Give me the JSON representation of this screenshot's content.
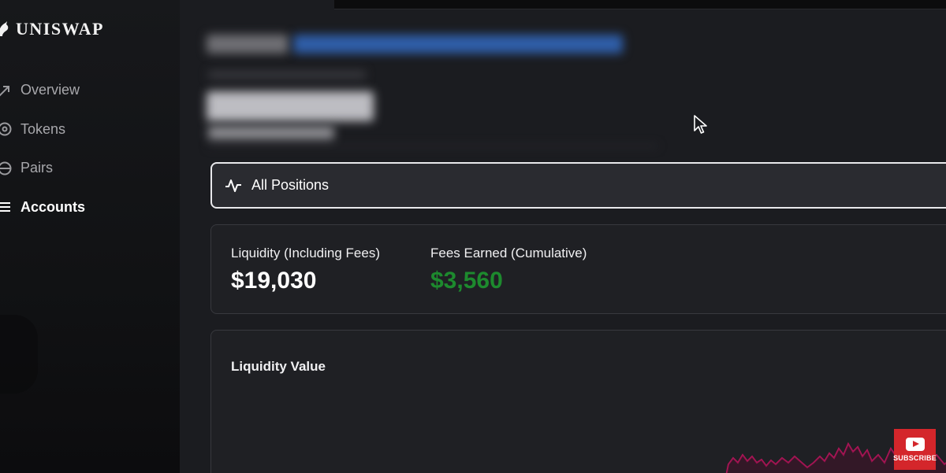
{
  "app": {
    "name": "UNISWAP"
  },
  "sidebar": {
    "items": [
      {
        "label": "Overview",
        "icon": "trending-up-icon",
        "active": false
      },
      {
        "label": "Tokens",
        "icon": "disc-icon",
        "active": false
      },
      {
        "label": "Pairs",
        "icon": "pie-chart-icon",
        "active": false
      },
      {
        "label": "Accounts",
        "icon": "list-icon",
        "active": true
      }
    ]
  },
  "positions": {
    "label": "All Positions",
    "icon": "activity-icon"
  },
  "stats": {
    "liquidity_label": "Liquidity (Including Fees)",
    "liquidity_value": "$19,030",
    "fees_label": "Fees Earned (Cumulative)",
    "fees_value": "$3,560"
  },
  "chart": {
    "title": "Liquidity Value"
  },
  "subscribe": {
    "label": "SUBSCRIBE"
  },
  "colors": {
    "background": "#1b1c20",
    "accent_green": "#1d8a2e",
    "chart_line": "#c0155f",
    "subscribe_red": "#d4262b"
  }
}
